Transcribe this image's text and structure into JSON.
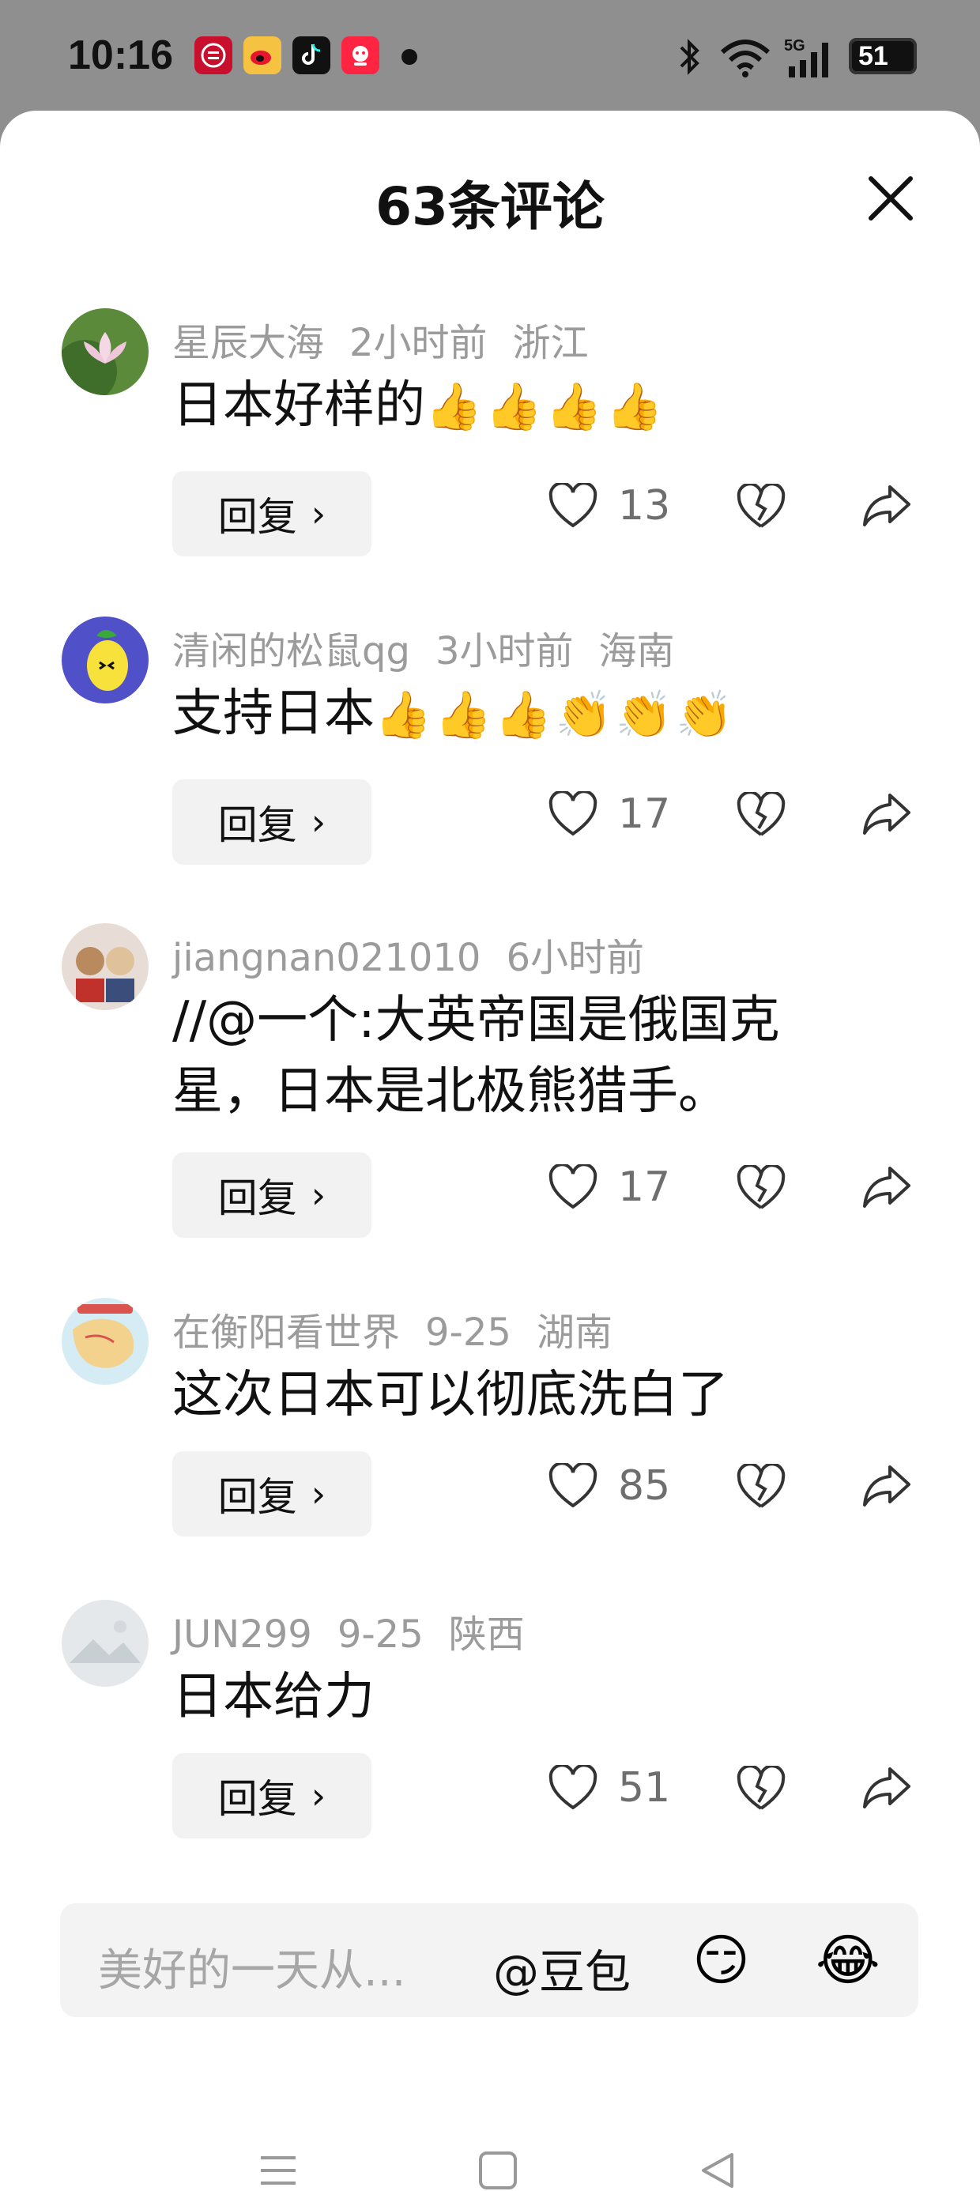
{
  "status_bar": {
    "time": "10:16",
    "network": "5G",
    "battery": "51"
  },
  "header": {
    "title": "63条评论"
  },
  "comments": [
    {
      "user": "星辰大海",
      "time": "2小时前",
      "location": "浙江",
      "text": "日本好样的",
      "emojis": "👍👍👍👍",
      "reply_label": "回复",
      "likes": "13",
      "avatar_icon": "lotus-avatar"
    },
    {
      "user": "清闲的松鼠qg",
      "time": "3小时前",
      "location": "海南",
      "text": "支持日本",
      "emojis": "👍👍👍👏👏👏",
      "reply_label": "回复",
      "likes": "17",
      "avatar_icon": "lemon-avatar"
    },
    {
      "user": "jiangnan021010",
      "time": "6小时前",
      "location": "",
      "text": "//@一个:大英帝国是俄国克星，日本是北极熊猎手。",
      "emojis": "",
      "reply_label": "回复",
      "likes": "17",
      "avatar_icon": "cats-avatar"
    },
    {
      "user": "在衡阳看世界",
      "time": "9-25",
      "location": "湖南",
      "text": "这次日本可以彻底洗白了",
      "emojis": "",
      "reply_label": "回复",
      "likes": "85",
      "avatar_icon": "map-avatar"
    },
    {
      "user": "JUN299",
      "time": "9-25",
      "location": "陕西",
      "text": "日本给力",
      "emojis": "",
      "reply_label": "回复",
      "likes": "51",
      "avatar_icon": "default-avatar"
    }
  ],
  "input": {
    "placeholder": "美好的一天从...",
    "mention": "@豆包",
    "emoji_1": "😏",
    "emoji_2": "😂"
  },
  "colors": {
    "dim_overlay": "#8f8f8f",
    "sheet_bg": "#ffffff",
    "muted_text": "#9b9b9b",
    "reply_bg": "#f2f2f2"
  }
}
